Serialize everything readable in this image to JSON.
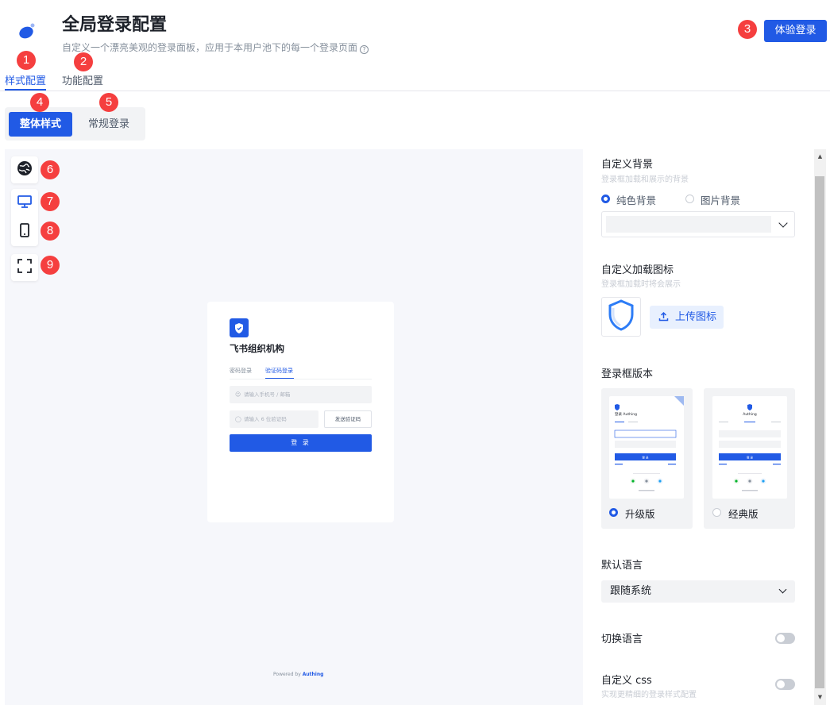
{
  "header": {
    "title": "全局登录配置",
    "subtitle": "自定义一个漂亮美观的登录面板，应用于本用户池下的每一个登录页面",
    "try_login_label": "体验登录"
  },
  "tabs": [
    {
      "label": "样式配置",
      "active": true
    },
    {
      "label": "功能配置",
      "active": false
    }
  ],
  "segments": [
    {
      "label": "整体样式",
      "active": true
    },
    {
      "label": "常规登录",
      "active": false
    }
  ],
  "badges": [
    "1",
    "2",
    "3",
    "4",
    "5",
    "6",
    "7",
    "8",
    "9"
  ],
  "toolbar": {
    "icons": [
      "globe-icon",
      "desktop-icon",
      "mobile-icon",
      "fullscreen-icon"
    ]
  },
  "preview": {
    "org_name": "飞书组织机构",
    "tab_password": "密码登录",
    "tab_code": "验证码登录",
    "phone_placeholder": "请输入手机号 / 邮箱",
    "code_placeholder": "请输入 6 位验证码",
    "send_code": "发送验证码",
    "login_button": "登 录",
    "powered_by": "Powered by",
    "brand": "Authing"
  },
  "settings": {
    "background": {
      "title": "自定义背景",
      "desc": "登录框加载和展示的背景",
      "options": [
        {
          "label": "纯色背景",
          "selected": true
        },
        {
          "label": "图片背景",
          "selected": false
        }
      ]
    },
    "loading_icon": {
      "title": "自定义加载图标",
      "desc": "登录框加载时将会展示",
      "upload_label": "上传图标"
    },
    "version": {
      "title": "登录框版本",
      "options": [
        {
          "label": "升级版",
          "selected": true
        },
        {
          "label": "经典版",
          "selected": false
        }
      ],
      "thumb_brand": "登录 Authing",
      "thumb_brand_classic": "Authing",
      "thumb_login": "登 录"
    },
    "language": {
      "title": "默认语言",
      "value": "跟随系统"
    },
    "switch_language": {
      "title": "切换语言",
      "enabled": false
    },
    "custom_css": {
      "title": "自定义 css",
      "desc": "实现更精细的登录样式配置",
      "enabled": false
    }
  },
  "colors": {
    "primary": "#215ae5",
    "badge": "#f53f3f"
  }
}
